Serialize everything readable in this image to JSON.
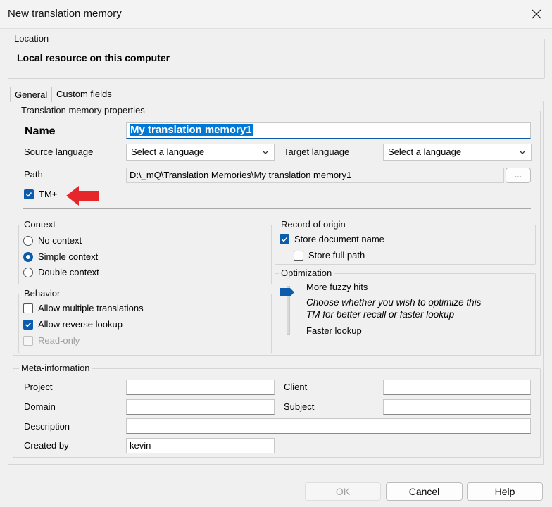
{
  "window": {
    "title": "New translation memory"
  },
  "location": {
    "legend": "Location",
    "value": "Local resource on this computer"
  },
  "tabs": [
    {
      "label": "General"
    },
    {
      "label": "Custom fields"
    }
  ],
  "tm_props": {
    "legend": "Translation memory properties",
    "name_label": "Name",
    "name_value": "My translation memory1",
    "source_label": "Source language",
    "source_value": "Select a language",
    "target_label": "Target language",
    "target_value": "Select a language",
    "path_label": "Path",
    "path_value": "D:\\_mQ\\Translation Memories\\My translation memory1",
    "browse_label": "...",
    "tmplus_label": "TM+",
    "tmplus_checked": true
  },
  "context": {
    "legend": "Context",
    "options": [
      {
        "label": "No context",
        "selected": false
      },
      {
        "label": "Simple context",
        "selected": true
      },
      {
        "label": "Double context",
        "selected": false
      }
    ]
  },
  "behavior": {
    "legend": "Behavior",
    "items": [
      {
        "label": "Allow multiple translations",
        "checked": false,
        "enabled": true
      },
      {
        "label": "Allow reverse lookup",
        "checked": true,
        "enabled": true
      },
      {
        "label": "Read-only",
        "checked": false,
        "enabled": false
      }
    ]
  },
  "record_origin": {
    "legend": "Record of origin",
    "store_doc_name": "Store document name",
    "store_doc_checked": true,
    "store_full_path": "Store full path",
    "store_path_checked": false
  },
  "optimization": {
    "legend": "Optimization",
    "top_label": "More fuzzy hits",
    "description": "Choose whether you wish to optimize this TM for better recall or faster lookup",
    "bottom_label": "Faster lookup",
    "slider_value": "More fuzzy hits"
  },
  "meta": {
    "legend": "Meta-information",
    "project_label": "Project",
    "project_value": "",
    "client_label": "Client",
    "client_value": "",
    "domain_label": "Domain",
    "domain_value": "",
    "subject_label": "Subject",
    "subject_value": "",
    "description_label": "Description",
    "description_value": "",
    "created_by_label": "Created by",
    "created_by_value": "kevin"
  },
  "buttons": {
    "ok": "OK",
    "cancel": "Cancel",
    "help": "Help"
  },
  "colors": {
    "accent": "#0b5cad",
    "selection": "#0078d7",
    "annotation_arrow": "#e5262b"
  }
}
